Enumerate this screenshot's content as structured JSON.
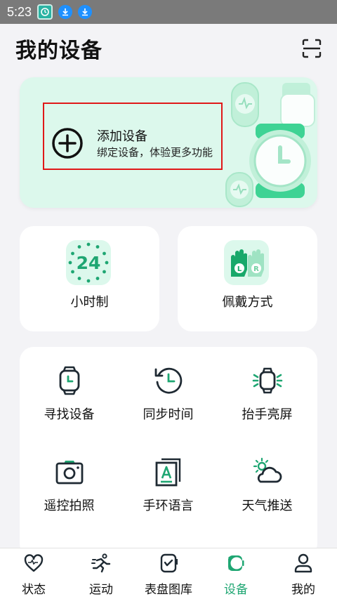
{
  "status_bar": {
    "time": "5:23"
  },
  "header": {
    "title": "我的设备"
  },
  "add_device": {
    "title": "添加设备",
    "subtitle": "绑定设备，体验更多功能"
  },
  "features": [
    {
      "label": "小时制",
      "icon": "24-hour-icon",
      "icon_text": "24"
    },
    {
      "label": "佩戴方式",
      "icon": "wearing-hands-icon",
      "left_mark": "L",
      "right_mark": "R"
    }
  ],
  "grid": [
    {
      "label": "寻找设备",
      "icon": "find-watch-icon"
    },
    {
      "label": "同步时间",
      "icon": "sync-time-icon"
    },
    {
      "label": "抬手亮屏",
      "icon": "raise-to-wake-icon"
    },
    {
      "label": "遥控拍照",
      "icon": "camera-icon"
    },
    {
      "label": "手环语言",
      "icon": "language-icon"
    },
    {
      "label": "天气推送",
      "icon": "weather-icon"
    }
  ],
  "tabs": [
    {
      "label": "状态",
      "icon": "heart-icon",
      "active": false
    },
    {
      "label": "运动",
      "icon": "running-icon",
      "active": false
    },
    {
      "label": "表盘图库",
      "icon": "watch-face-icon",
      "active": false
    },
    {
      "label": "设备",
      "icon": "device-icon",
      "active": true
    },
    {
      "label": "我的",
      "icon": "profile-icon",
      "active": false
    }
  ],
  "colors": {
    "accent": "#1ea672",
    "card_green": "#dcf8ec",
    "highlight": "#e01818"
  }
}
